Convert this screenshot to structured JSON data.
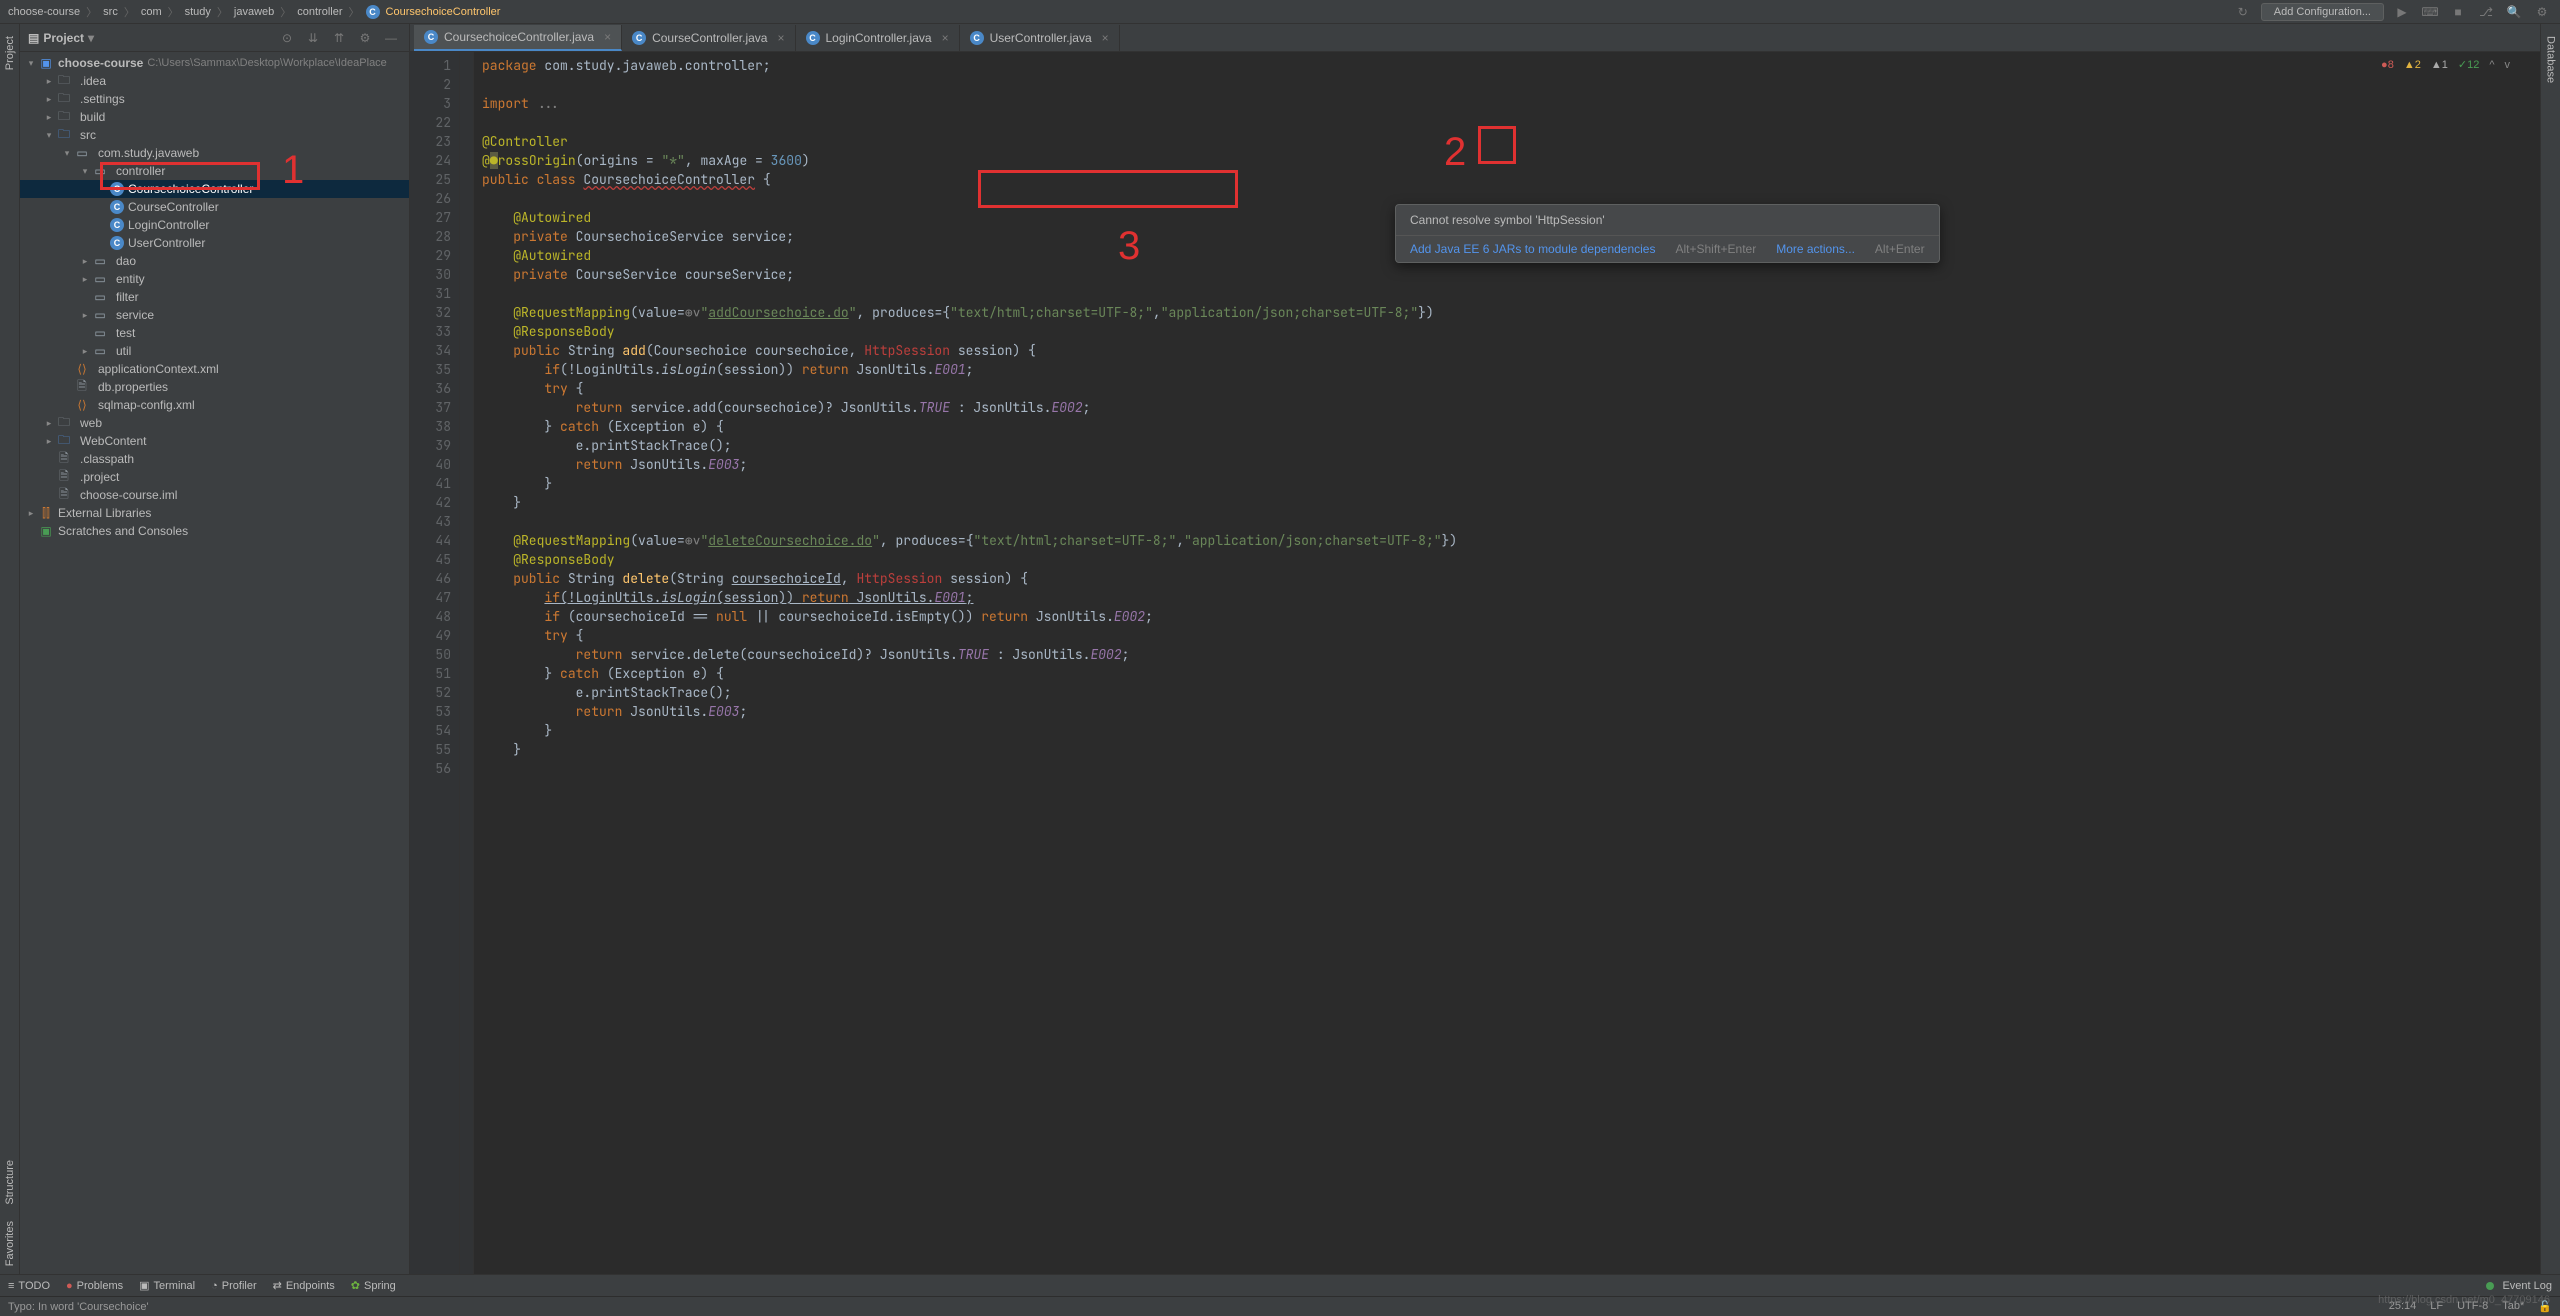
{
  "breadcrumb": [
    "choose-course",
    "src",
    "com",
    "study",
    "javaweb",
    "controller",
    "CoursechoiceController"
  ],
  "top_right": {
    "config": "Add Configuration..."
  },
  "project": {
    "title": "Project",
    "root": "choose-course",
    "root_path": "C:\\Users\\Sammax\\Desktop\\Workplace\\IdeaPlace",
    "items": [
      {
        "indent": 1,
        "arrow": ">",
        "icon": "folder",
        "label": ".idea"
      },
      {
        "indent": 1,
        "arrow": ">",
        "icon": "folder",
        "label": ".settings"
      },
      {
        "indent": 1,
        "arrow": ">",
        "icon": "folder",
        "label": "build"
      },
      {
        "indent": 1,
        "arrow": "v",
        "icon": "src",
        "label": "src"
      },
      {
        "indent": 2,
        "arrow": "v",
        "icon": "pkg",
        "label": "com.study.javaweb"
      },
      {
        "indent": 3,
        "arrow": "v",
        "icon": "pkg",
        "label": "controller"
      },
      {
        "indent": 4,
        "arrow": "",
        "icon": "class",
        "label": "CoursechoiceController",
        "selected": true
      },
      {
        "indent": 4,
        "arrow": "",
        "icon": "class",
        "label": "CourseController"
      },
      {
        "indent": 4,
        "arrow": "",
        "icon": "class",
        "label": "LoginController"
      },
      {
        "indent": 4,
        "arrow": "",
        "icon": "class",
        "label": "UserController"
      },
      {
        "indent": 3,
        "arrow": ">",
        "icon": "pkg",
        "label": "dao"
      },
      {
        "indent": 3,
        "arrow": ">",
        "icon": "pkg",
        "label": "entity"
      },
      {
        "indent": 3,
        "arrow": "",
        "icon": "pkg",
        "label": "filter"
      },
      {
        "indent": 3,
        "arrow": ">",
        "icon": "pkg",
        "label": "service"
      },
      {
        "indent": 3,
        "arrow": "",
        "icon": "pkg",
        "label": "test"
      },
      {
        "indent": 3,
        "arrow": ">",
        "icon": "pkg",
        "label": "util"
      },
      {
        "indent": 2,
        "arrow": "",
        "icon": "xml",
        "label": "applicationContext.xml"
      },
      {
        "indent": 2,
        "arrow": "",
        "icon": "file",
        "label": "db.properties"
      },
      {
        "indent": 2,
        "arrow": "",
        "icon": "xml",
        "label": "sqlmap-config.xml"
      },
      {
        "indent": 1,
        "arrow": ">",
        "icon": "folder",
        "label": "web"
      },
      {
        "indent": 1,
        "arrow": ">",
        "icon": "webfolder",
        "label": "WebContent"
      },
      {
        "indent": 1,
        "arrow": "",
        "icon": "file",
        "label": ".classpath"
      },
      {
        "indent": 1,
        "arrow": "",
        "icon": "file",
        "label": ".project"
      },
      {
        "indent": 1,
        "arrow": "",
        "icon": "file",
        "label": "choose-course.iml"
      }
    ],
    "ext_libs": "External Libraries",
    "scratches": "Scratches and Consoles"
  },
  "tabs": [
    {
      "label": "CoursechoiceController.java",
      "active": true
    },
    {
      "label": "CourseController.java",
      "active": false
    },
    {
      "label": "LoginController.java",
      "active": false
    },
    {
      "label": "UserController.java",
      "active": false
    }
  ],
  "stats": {
    "errors": "8",
    "warnings": "2",
    "weak": "1",
    "typos": "12"
  },
  "gutter_lines": [
    "1",
    "2",
    "3",
    "22",
    "23",
    "24",
    "25",
    "26",
    "27",
    "28",
    "29",
    "30",
    "31",
    "32",
    "33",
    "34",
    "35",
    "36",
    "37",
    "38",
    "39",
    "40",
    "41",
    "42",
    "43",
    "44",
    "45",
    "46",
    "47",
    "48",
    "49",
    "50",
    "51",
    "52",
    "53",
    "54",
    "55",
    "56"
  ],
  "popup": {
    "error": "Cannot resolve symbol 'HttpSession'",
    "fix": "Add Java EE 6 JARs to module dependencies",
    "fix_shortcut": "Alt+Shift+Enter",
    "more": "More actions...",
    "more_shortcut": "Alt+Enter"
  },
  "bottom": {
    "todo": "TODO",
    "problems": "Problems",
    "terminal": "Terminal",
    "profiler": "Profiler",
    "endpoints": "Endpoints",
    "spring": "Spring",
    "eventlog": "Event Log"
  },
  "status": {
    "typo": "Typo: In word 'Coursechoice'",
    "pos": "25:14",
    "lf": "LF",
    "enc": "UTF-8",
    "indent": "Tab*"
  },
  "annotations": {
    "a1": "1",
    "a2": "2",
    "a3": "3"
  },
  "side_tabs": {
    "project": "Project",
    "structure": "Structure",
    "favorites": "Favorites",
    "database": "Database"
  },
  "watermark": "https://blog.csdn.net/m0_47709146"
}
